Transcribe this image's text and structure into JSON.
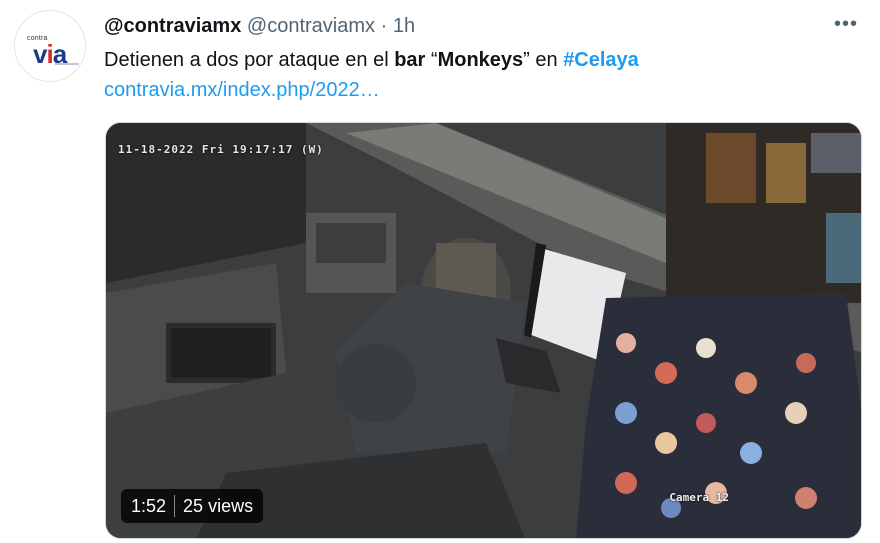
{
  "avatar": {
    "logo_small": "contra",
    "logo_main_left": "v",
    "logo_main_mid": "i",
    "logo_main_right": "a"
  },
  "tweet": {
    "display_name": "@contraviamx",
    "handle": "@contraviamx",
    "separator": "·",
    "time": "1h",
    "text_part1": "Detienen a dos por ataque en el ",
    "text_bold1": "bar",
    "text_part2": " “",
    "text_bold2": "Monkeys",
    "text_part3": "” en ",
    "hashtag": "#Celaya",
    "link": "contravia.mx/index.php/2022…"
  },
  "more_icon": "more-horizontal-icon",
  "video": {
    "timestamp_overlay": "11-18-2022 Fri 19:17:17 (W)",
    "camera_label": "Camera 12",
    "duration": "1:52",
    "views": "25 views"
  }
}
